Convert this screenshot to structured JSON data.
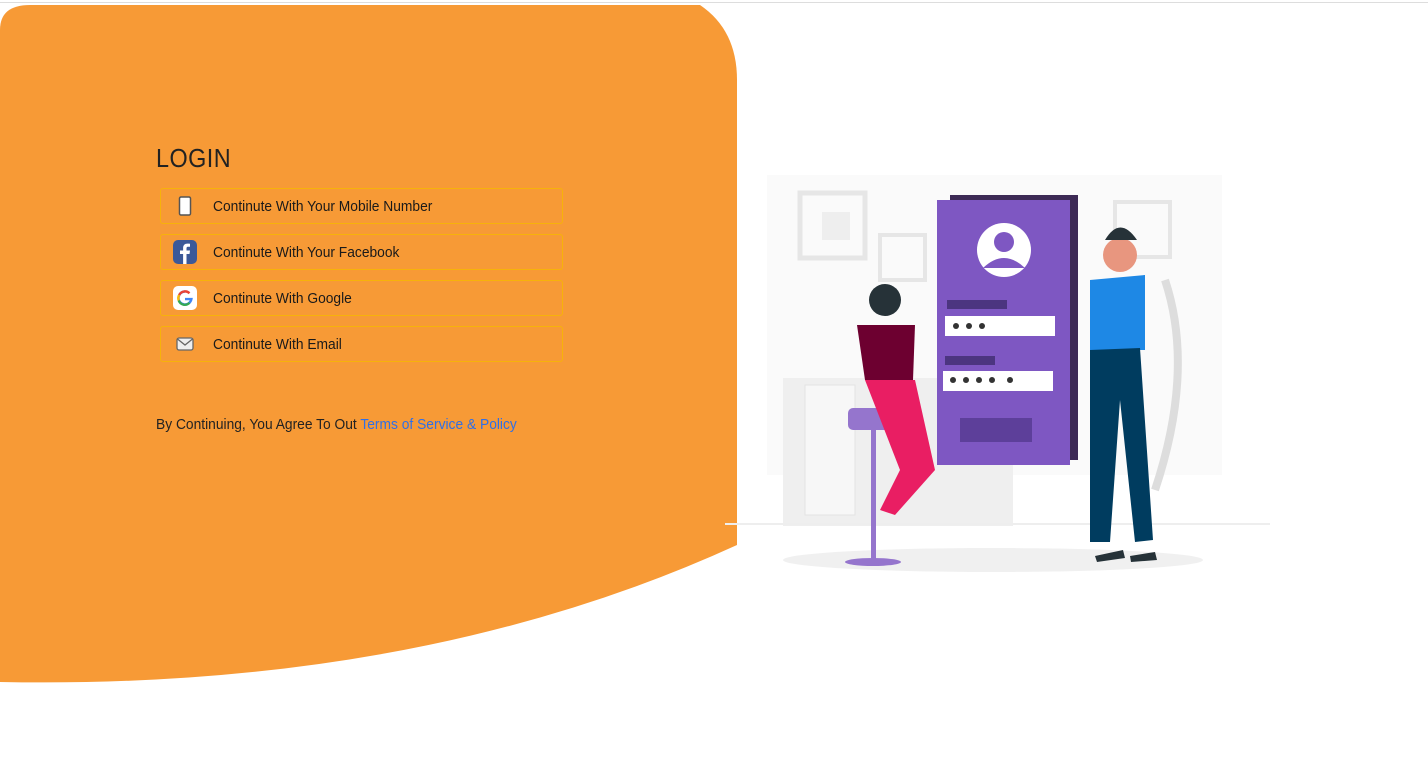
{
  "login": {
    "title": "LOGIN",
    "options": [
      {
        "label": "Continute With Your Mobile Number",
        "icon": "mobile-phone-icon"
      },
      {
        "label": "Continute With Your Facebook",
        "icon": "facebook-icon"
      },
      {
        "label": "Continute With Google",
        "icon": "google-icon"
      },
      {
        "label": "Continute With Email",
        "icon": "email-icon"
      }
    ],
    "terms_prefix": "By Continuing, You Agree To Out ",
    "terms_link": "Terms of Service & Policy"
  },
  "colors": {
    "accent": "#f79a36",
    "border": "#f7b20a",
    "link": "#2f6fe8",
    "illustration_purple": "#7e57c2"
  }
}
